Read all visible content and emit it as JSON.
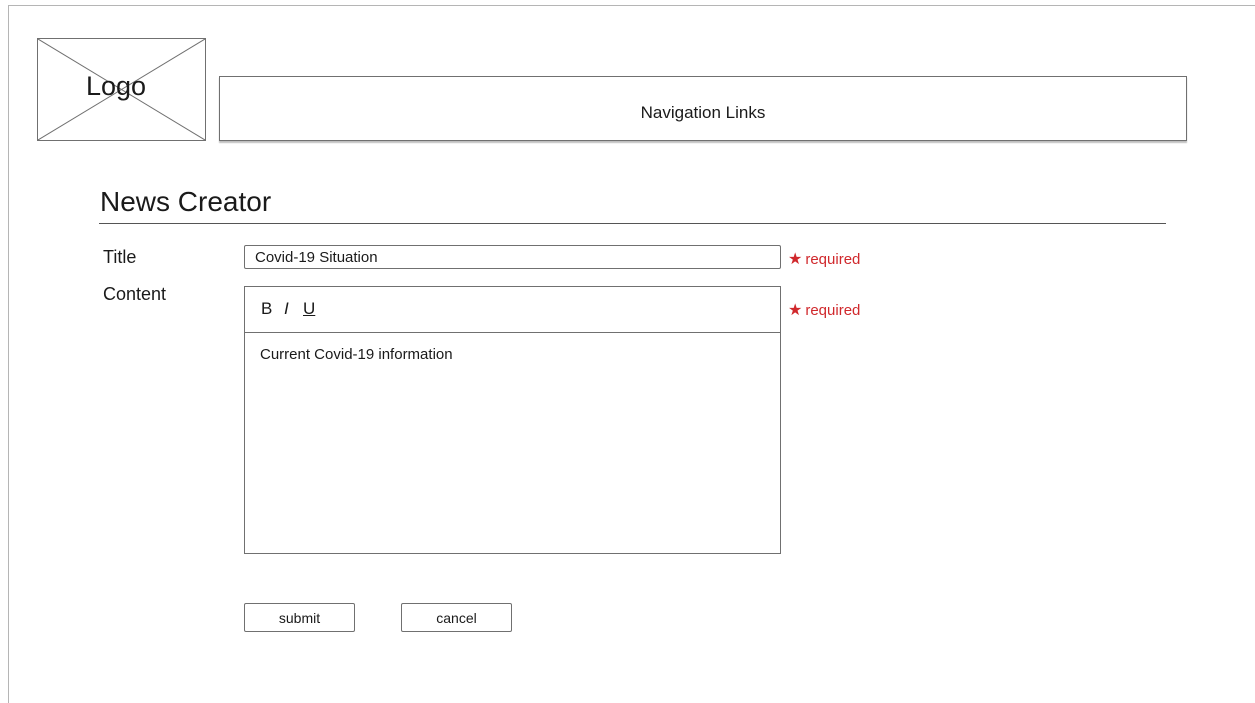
{
  "header": {
    "logo_text": "Logo",
    "nav_text": "Navigation Links"
  },
  "page": {
    "title": "News Creator"
  },
  "form": {
    "title_label": "Title",
    "title_value": "Covid-19 Situation",
    "content_label": "Content",
    "required_text": "required",
    "required_marker": "★",
    "toolbar": {
      "bold": "B",
      "italic": "I",
      "underline": "U"
    },
    "content_value": "Current Covid-19 information",
    "submit_label": "submit",
    "cancel_label": "cancel"
  },
  "colors": {
    "required": "#d0282c",
    "border": "#707070"
  },
  "icons": {
    "logo_placeholder": "image-placeholder-icon",
    "required_marker": "star-icon"
  }
}
